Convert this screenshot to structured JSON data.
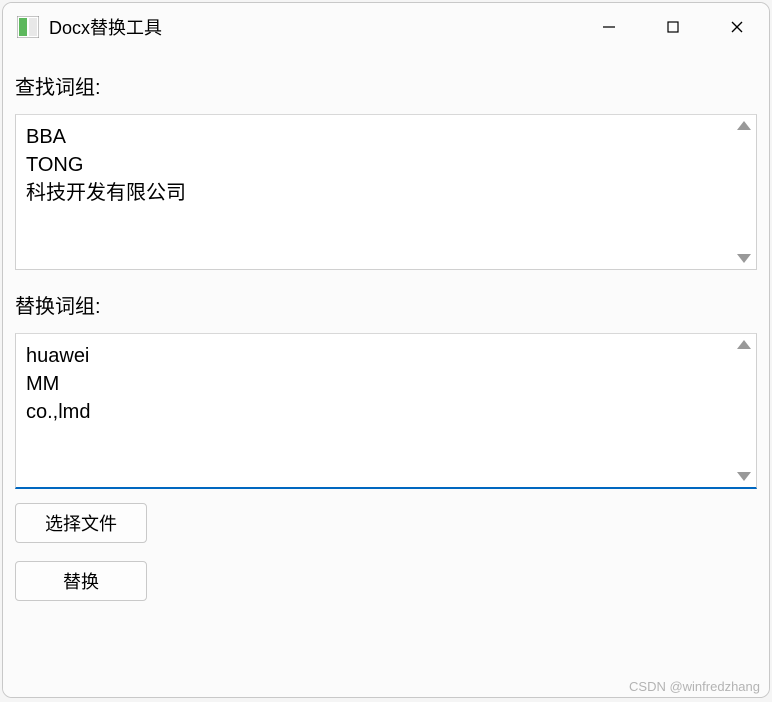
{
  "window": {
    "title": "Docx替换工具"
  },
  "labels": {
    "find": "查找词组:",
    "replace": "替换词组:"
  },
  "find_text": "BBA\nTONG\n科技开发有限公司",
  "replace_text": "huawei\nMM\nco.,lmd",
  "buttons": {
    "select_file": "选择文件",
    "replace": "替换"
  },
  "watermark": "CSDN @winfredzhang"
}
